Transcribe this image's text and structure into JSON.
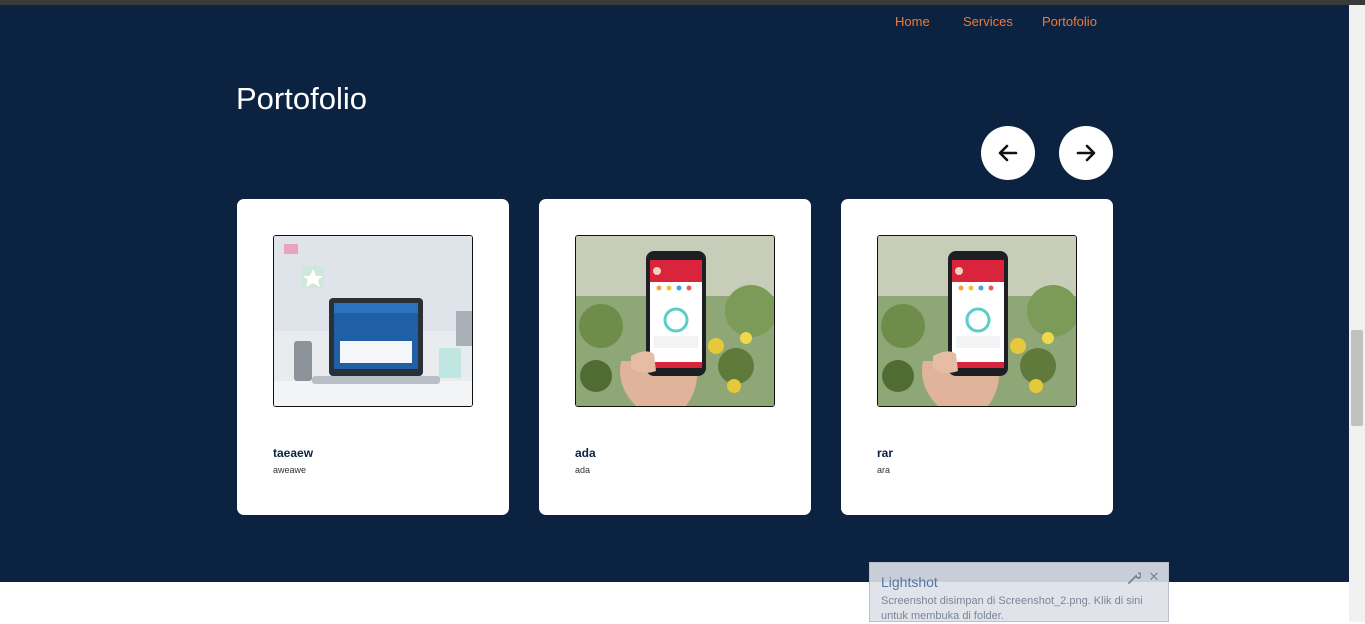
{
  "nav": {
    "items": [
      {
        "label": "Home"
      },
      {
        "label": "Services"
      },
      {
        "label": "Portofolio"
      }
    ]
  },
  "section": {
    "title": "Portofolio"
  },
  "carousel": {
    "prev_icon": "arrow-left-icon",
    "next_icon": "arrow-right-icon"
  },
  "cards": [
    {
      "title": "taeaew",
      "desc": "aweawe",
      "image": "laptop-photo"
    },
    {
      "title": "ada",
      "desc": "ada",
      "image": "phone-app-photo"
    },
    {
      "title": "rar",
      "desc": "ara",
      "image": "phone-app-photo"
    }
  ],
  "toast": {
    "title": "Lightshot",
    "message": "Screenshot disimpan di Screenshot_2.png. Klik di sini untuk membuka di folder."
  },
  "colors": {
    "background": "#0b2240",
    "nav_link": "#f0793d",
    "card": "#ffffff"
  }
}
